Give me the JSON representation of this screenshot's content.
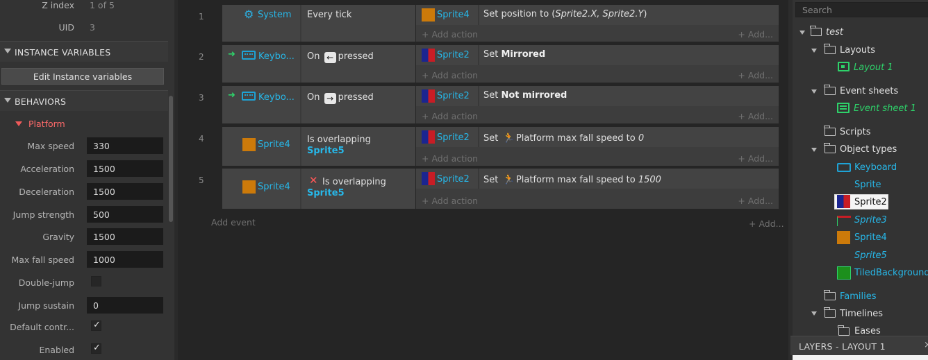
{
  "properties": {
    "zindex_label": "Z index",
    "zindex_value": "1 of 5",
    "uid_label": "UID",
    "uid_value": "3",
    "instance_vars_header": "INSTANCE VARIABLES",
    "edit_instance_vars": "Edit Instance variables",
    "behaviors_header": "BEHAVIORS",
    "platform_header": "Platform",
    "rows": [
      {
        "label": "Max speed",
        "value": "330"
      },
      {
        "label": "Acceleration",
        "value": "1500"
      },
      {
        "label": "Deceleration",
        "value": "1500"
      },
      {
        "label": "Jump strength",
        "value": "500"
      },
      {
        "label": "Gravity",
        "value": "1500"
      },
      {
        "label": "Max fall speed",
        "value": "1000"
      },
      {
        "label": "Double-jump",
        "value": ""
      },
      {
        "label": "Jump sustain",
        "value": "0"
      },
      {
        "label": "Default contr...",
        "value": ""
      },
      {
        "label": "Enabled",
        "value": ""
      }
    ]
  },
  "events": [
    {
      "num": "1",
      "cond_object": "System",
      "cond_text": "Every tick",
      "act_object": "Sprite4",
      "act_prefix": "Set position to (",
      "act_arg": "Sprite2.X, Sprite2.Y",
      "act_suffix": ")",
      "add_action": "+ Add action",
      "add": "+ Add..."
    },
    {
      "num": "2",
      "cond_object": "Keybo...",
      "cond_pre": "On",
      "cond_key": "←",
      "cond_post": "pressed",
      "act_object": "Sprite2",
      "act_prefix": "Set",
      "act_bold": "Mirrored",
      "add_action": "+ Add action",
      "add": "+ Add..."
    },
    {
      "num": "3",
      "cond_object": "Keybo...",
      "cond_pre": "On",
      "cond_key": "→",
      "cond_post": "pressed",
      "act_object": "Sprite2",
      "act_prefix": "Set",
      "act_bold": "Not mirrored",
      "add_action": "+ Add action",
      "add": "+ Add..."
    },
    {
      "num": "4",
      "cond_object": "Sprite4",
      "cond_text": "Is overlapping",
      "cond_target": "Sprite5",
      "act_object": "Sprite2",
      "act_prefix": "Set",
      "act_mid": "Platform max fall speed to",
      "act_arg": "0",
      "add_action": "+ Add action",
      "add": "+ Add..."
    },
    {
      "num": "5",
      "cond_object": "Sprite4",
      "cond_text": "Is overlapping",
      "cond_target": "Sprite5",
      "act_object": "Sprite2",
      "act_prefix": "Set",
      "act_mid": "Platform max fall speed to",
      "act_arg": "1500",
      "add_action": "+ Add action",
      "add": "+ Add..."
    }
  ],
  "sheet": {
    "add_event": "Add event",
    "add": "+ Add..."
  },
  "project": {
    "search_placeholder": "Search",
    "root": "test",
    "layouts": "Layouts",
    "layout1": "Layout 1",
    "event_sheets": "Event sheets",
    "event_sheet1": "Event sheet 1",
    "scripts": "Scripts",
    "object_types": "Object types",
    "objects": [
      "Keyboard",
      "Sprite",
      "Sprite2",
      "Sprite3",
      "Sprite4",
      "Sprite5",
      "TiledBackground"
    ],
    "families": "Families",
    "timelines": "Timelines",
    "easings": "Eases"
  },
  "layers_bar": {
    "title": "LAYERS - LAYOUT 1",
    "close": "×"
  },
  "colors": {
    "accent_cyan": "#27b7e8",
    "accent_green": "#2ed26a",
    "accent_red": "#ff6a6a",
    "sprite4_orange": "#cc7a0a"
  }
}
